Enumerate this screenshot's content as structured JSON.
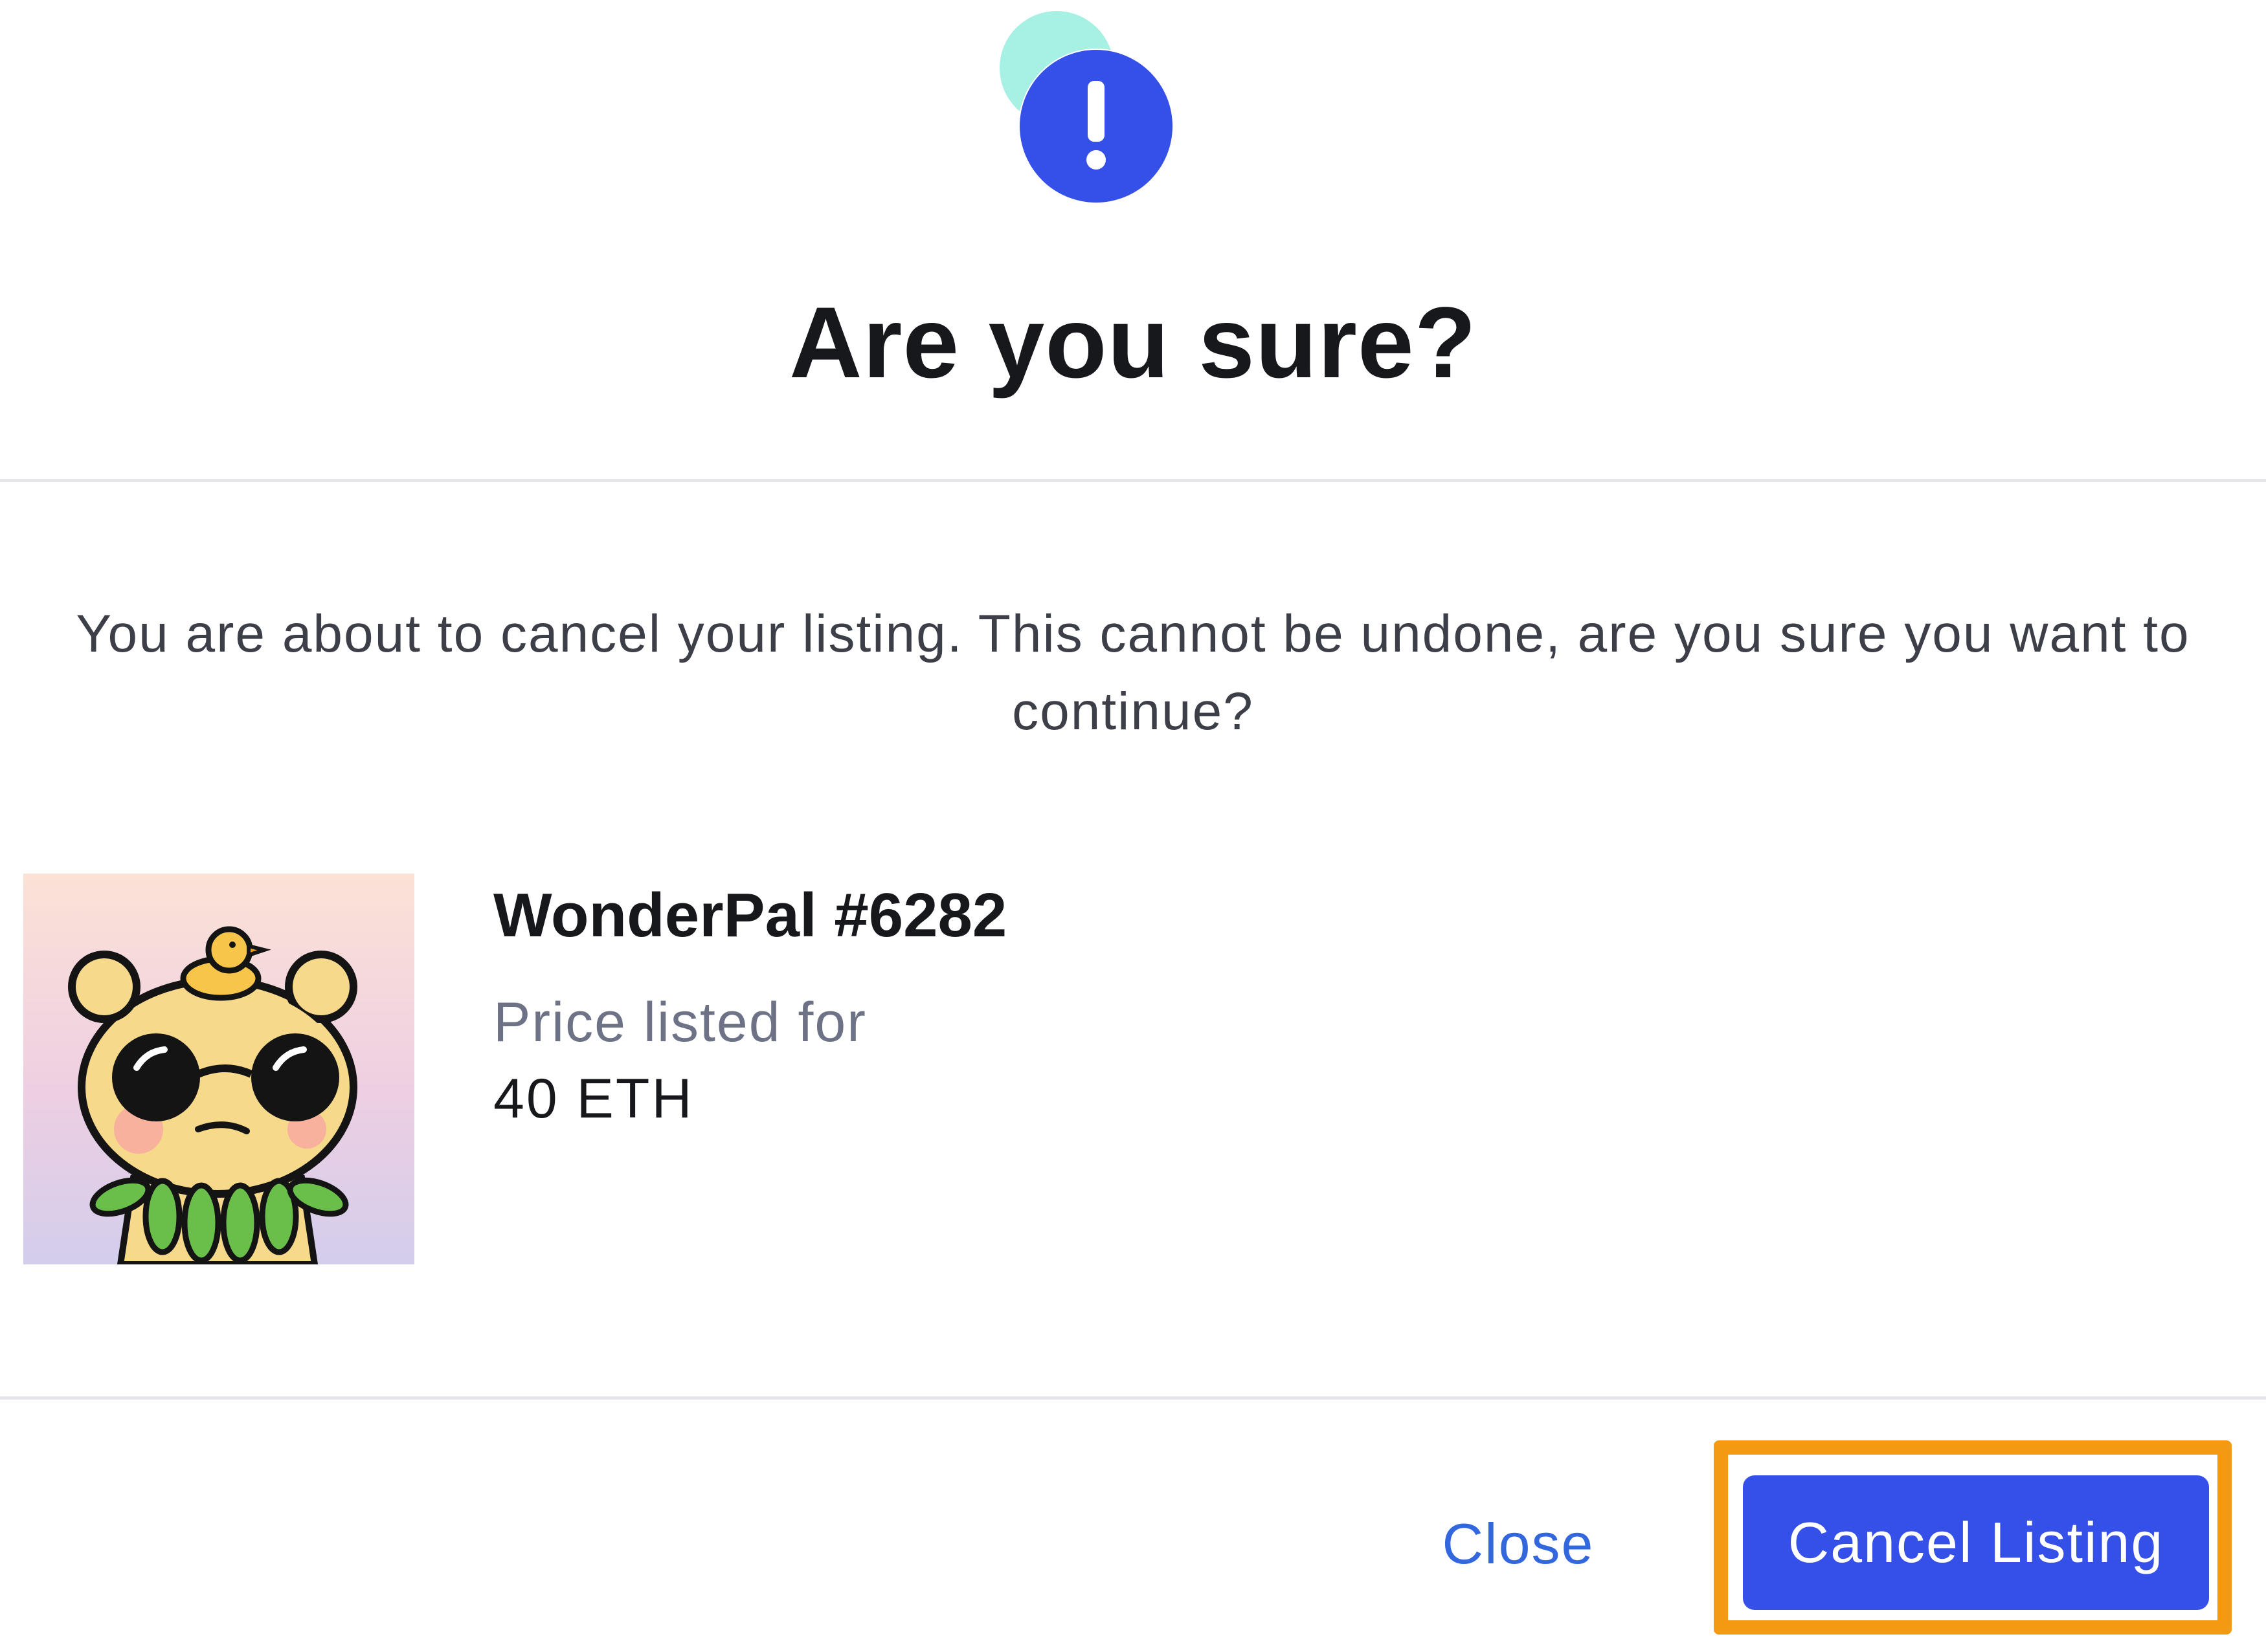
{
  "dialog": {
    "icon": "exclamation-icon",
    "title": "Are you sure?",
    "message": "You are about to cancel your listing. This cannot be undone, are you sure you want to continue?"
  },
  "item": {
    "name": "WonderPal #6282",
    "image": "wonderpal-nft-image",
    "price_label": "Price listed for",
    "price_value": "40 ETH"
  },
  "actions": {
    "close_label": "Close",
    "cancel_listing_label": "Cancel Listing"
  },
  "colors": {
    "accent": "#3550e8",
    "link": "#3267dd",
    "highlight": "#f39a12",
    "icon_bubble": "#a6f0e4"
  }
}
